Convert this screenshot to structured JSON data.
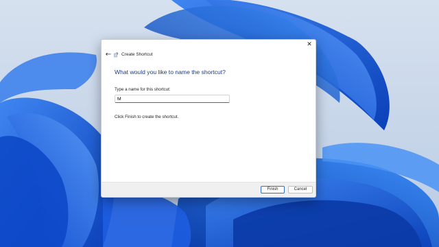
{
  "dialog": {
    "title": "Create Shortcut",
    "back_glyph": "←",
    "close_glyph": "✕",
    "heading": "What would you like to name the shortcut?",
    "field_label": "Type a name for this shortcut:",
    "name_value": "M",
    "instruction": "Click Finish to create the shortcut.",
    "buttons": {
      "finish": "Finish",
      "cancel": "Cancel"
    }
  },
  "icons": {
    "back": "back-arrow-icon",
    "wizard": "shortcut-wizard-icon",
    "close": "close-icon"
  },
  "colors": {
    "heading": "#1b3a86",
    "accent": "#2c6fc8",
    "wallpaper_bloom": "#1a5be0"
  }
}
